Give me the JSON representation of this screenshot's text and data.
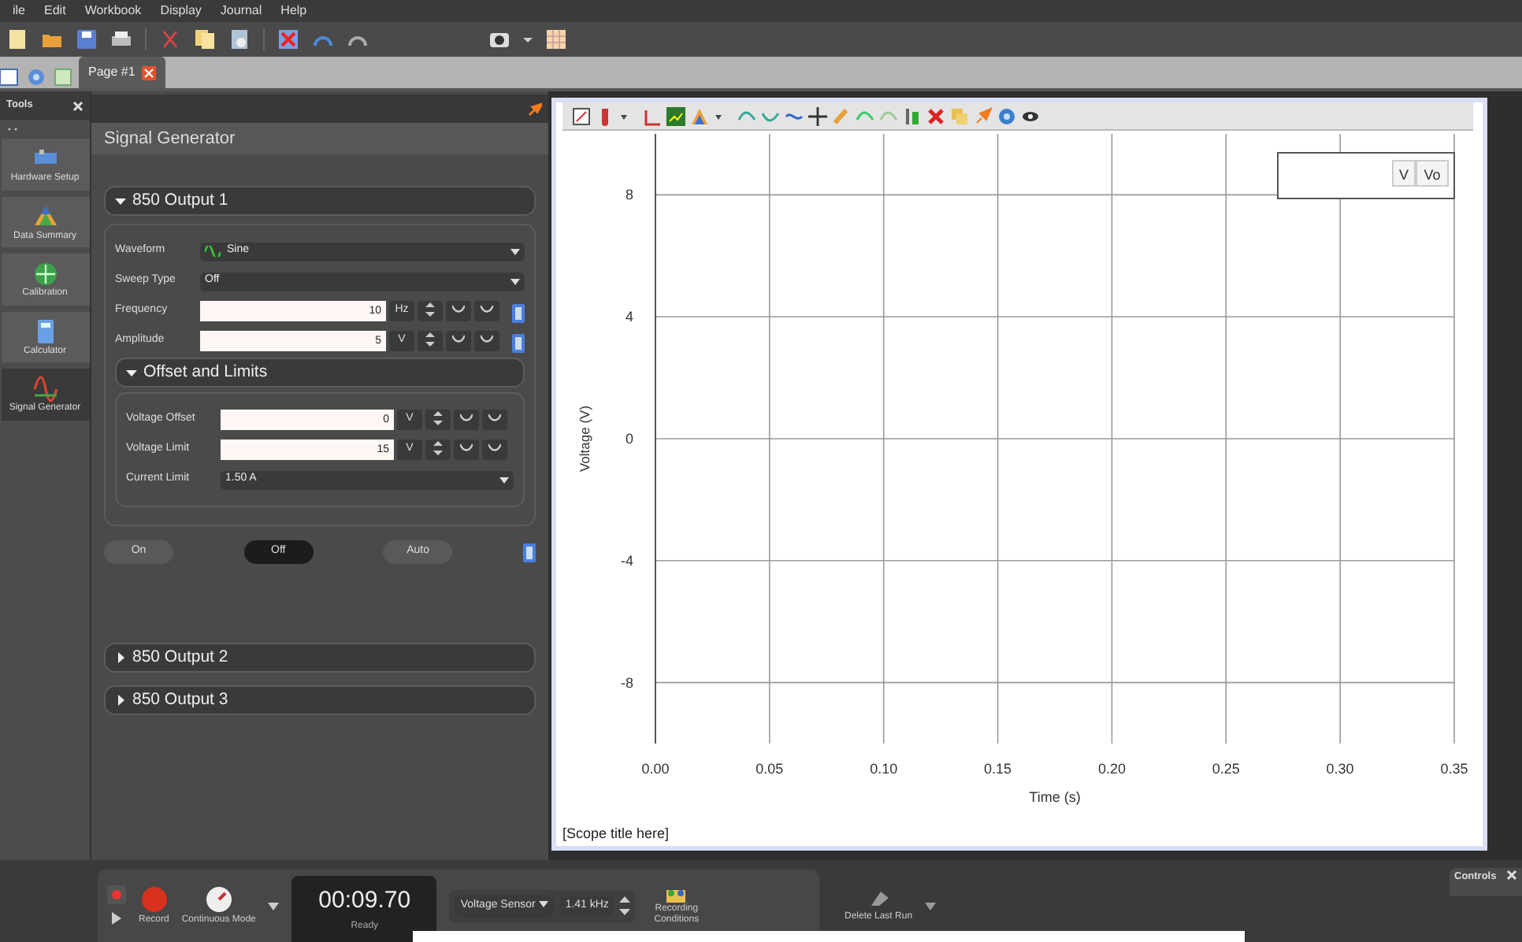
{
  "menu": [
    "ile",
    "Edit",
    "Workbook",
    "Display",
    "Journal",
    "Help"
  ],
  "page_tabs": [
    {
      "label": "Page #1",
      "selected": true
    }
  ],
  "tools": {
    "title": "Tools",
    "items": [
      {
        "label": "Hardware Setup",
        "selected": false
      },
      {
        "label": "Data Summary",
        "selected": false
      },
      {
        "label": "Calibration",
        "selected": false
      },
      {
        "label": "Calculator",
        "selected": false
      },
      {
        "label": "Signal Generator",
        "selected": true
      }
    ]
  },
  "signal_generator": {
    "title": "Signal Generator",
    "outputs": [
      {
        "label": "850 Output 1",
        "expanded": true,
        "rows": [
          {
            "kind": "wave-select",
            "label": "Waveform",
            "value": "Sine"
          },
          {
            "kind": "select",
            "label": "Sweep Type",
            "value": "Off"
          },
          {
            "kind": "number",
            "label": "Frequency",
            "value": "10",
            "unit": "Hz"
          },
          {
            "kind": "number",
            "label": "Amplitude",
            "value": "5",
            "unit": "V"
          }
        ],
        "subsection": {
          "label": "Offset and Limits",
          "expanded": true,
          "rows": [
            {
              "kind": "number",
              "label": "Voltage Offset",
              "value": "0",
              "unit": "V"
            },
            {
              "kind": "number",
              "label": "Voltage Limit",
              "value": "15",
              "unit": "V"
            },
            {
              "kind": "select",
              "label": "Current Limit",
              "value": "1.50 A"
            }
          ]
        },
        "modes": [
          {
            "label": "On",
            "selected": false
          },
          {
            "label": "Off",
            "selected": true
          },
          {
            "label": "Auto",
            "selected": false
          }
        ]
      },
      {
        "label": "850 Output 2",
        "expanded": false
      },
      {
        "label": "850 Output 3",
        "expanded": false
      }
    ]
  },
  "scope": {
    "chart_data": {
      "type": "line",
      "grid": true,
      "xlabel": "Time (s)",
      "ylabel": "Voltage (V)",
      "xlim": [
        0,
        0.35
      ],
      "ylim": [
        -10,
        10
      ],
      "xticks": [
        {
          "value": 0,
          "label": "0.00"
        },
        {
          "value": 0.05,
          "label": "0.05"
        },
        {
          "value": 0.1,
          "label": "0.10"
        },
        {
          "value": 0.15,
          "label": "0.15"
        },
        {
          "value": 0.2,
          "label": "0.20"
        },
        {
          "value": 0.25,
          "label": "0.25"
        },
        {
          "value": 0.3,
          "label": "0.30"
        },
        {
          "value": 0.35,
          "label": "0.35"
        }
      ],
      "yticks": [
        8,
        4,
        0,
        -4,
        -8
      ]
    },
    "legend": [
      "V",
      "Vo"
    ],
    "title_placeholder": "[Scope title here]"
  },
  "controls": {
    "record": "Record",
    "mode": "Continuous Mode",
    "timer": "00:09.70",
    "status": "Ready",
    "sensor": "Voltage Sensor",
    "rate": "1.41 kHz",
    "conditions": "Recording Conditions",
    "delete": "Delete Last Run"
  },
  "controls_panel": {
    "title": "Controls"
  }
}
